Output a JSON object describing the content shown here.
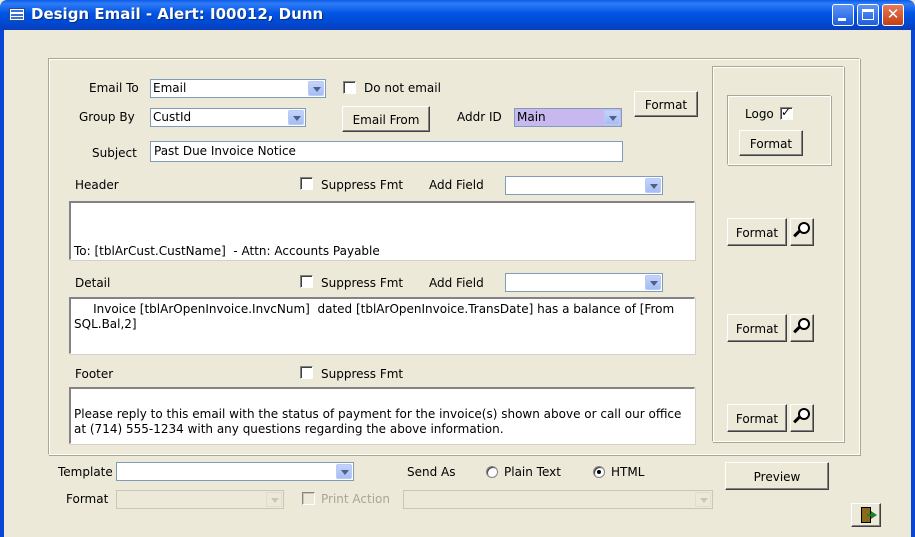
{
  "window": {
    "title": "Design Email - Alert: I00012, Dunn"
  },
  "recipients": {
    "email_to_label": "Email To",
    "email_to_value": "Email",
    "do_not_email_label": "Do not email",
    "do_not_email_checked": false,
    "group_by_label": "Group By",
    "group_by_value": "CustId",
    "email_from_label": "Email From",
    "addr_id_label": "Addr ID",
    "addr_id_value": "Main",
    "format_label": "Format",
    "subject_label": "Subject",
    "subject_value": "Past Due Invoice Notice"
  },
  "logo": {
    "label": "Logo",
    "checked": true,
    "format_label": "Format"
  },
  "header": {
    "label": "Header",
    "suppress_fmt_label": "Suppress Fmt",
    "suppress_fmt_checked": false,
    "add_field_label": "Add Field",
    "add_field_value": "",
    "body": "\nTo: [tblArCust.CustName]  - Attn: Accounts Payable",
    "format_label": "Format"
  },
  "detail": {
    "label": "Detail",
    "suppress_fmt_label": "Suppress Fmt",
    "suppress_fmt_checked": false,
    "add_field_label": "Add Field",
    "add_field_value": "",
    "body": "     Invoice [tblArOpenInvoice.InvcNum]  dated [tblArOpenInvoice.TransDate] has a balance of [From SQL.Bal,2]",
    "format_label": "Format"
  },
  "footer": {
    "label": "Footer",
    "suppress_fmt_label": "Suppress Fmt",
    "suppress_fmt_checked": false,
    "body": "Please reply to this email with the status of payment for the invoice(s) shown above or call our office at (714) 555-1234 with any questions regarding the above information.",
    "format_label": "Format"
  },
  "bottom": {
    "template_label": "Template",
    "template_value": "",
    "send_as_label": "Send As",
    "plain_text_label": "Plain Text",
    "html_label": "HTML",
    "send_as_selected": "HTML",
    "preview_label": "Preview",
    "format_label": "Format",
    "format_value": "",
    "print_action_label": "Print Action",
    "print_action_value": ""
  },
  "icons": {
    "title": "form-icon",
    "preview": "magnifier-icon",
    "exit": "exit-door-icon"
  },
  "colors": {
    "titlebar": "#0054e3",
    "face": "#ece9d8",
    "addr_highlight": "#c8b8f0"
  }
}
